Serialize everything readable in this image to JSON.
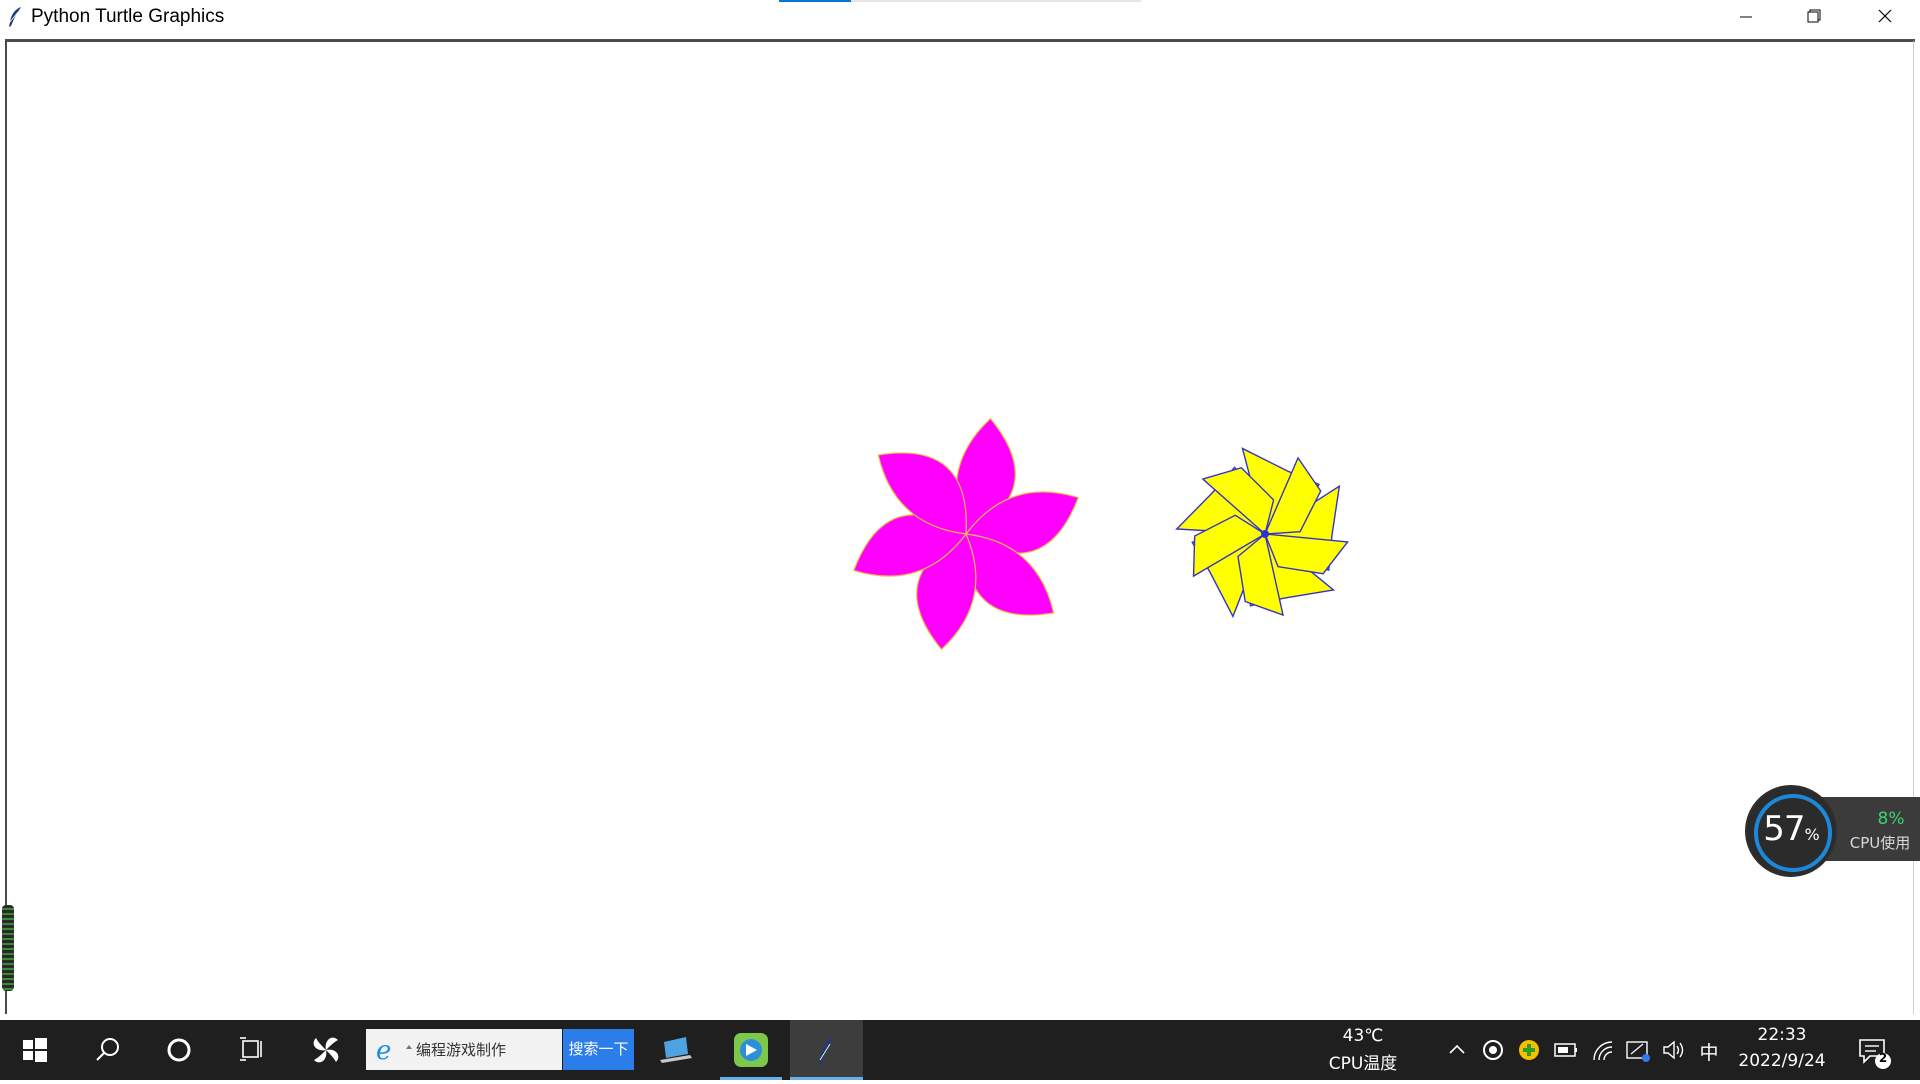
{
  "window": {
    "title": "Python Turtle Graphics"
  },
  "taskbar": {
    "search_text": "编程游戏制作",
    "search_button": "搜索一下",
    "cpu_temp_value": "43℃",
    "cpu_temp_label": "CPU温度",
    "ime": "中",
    "time": "22:33",
    "date": "2022/9/24",
    "notification_count": "2"
  },
  "cpu_widget": {
    "memory_percent": "57",
    "percent_sign": "%",
    "cpu_percent": "8%",
    "cpu_label": "CPU使用"
  },
  "colors": {
    "flower_fill": "#ff00ff",
    "flower_outline": "#f0c040",
    "star_fill": "#ffff00",
    "star_outline": "#3333cc"
  }
}
